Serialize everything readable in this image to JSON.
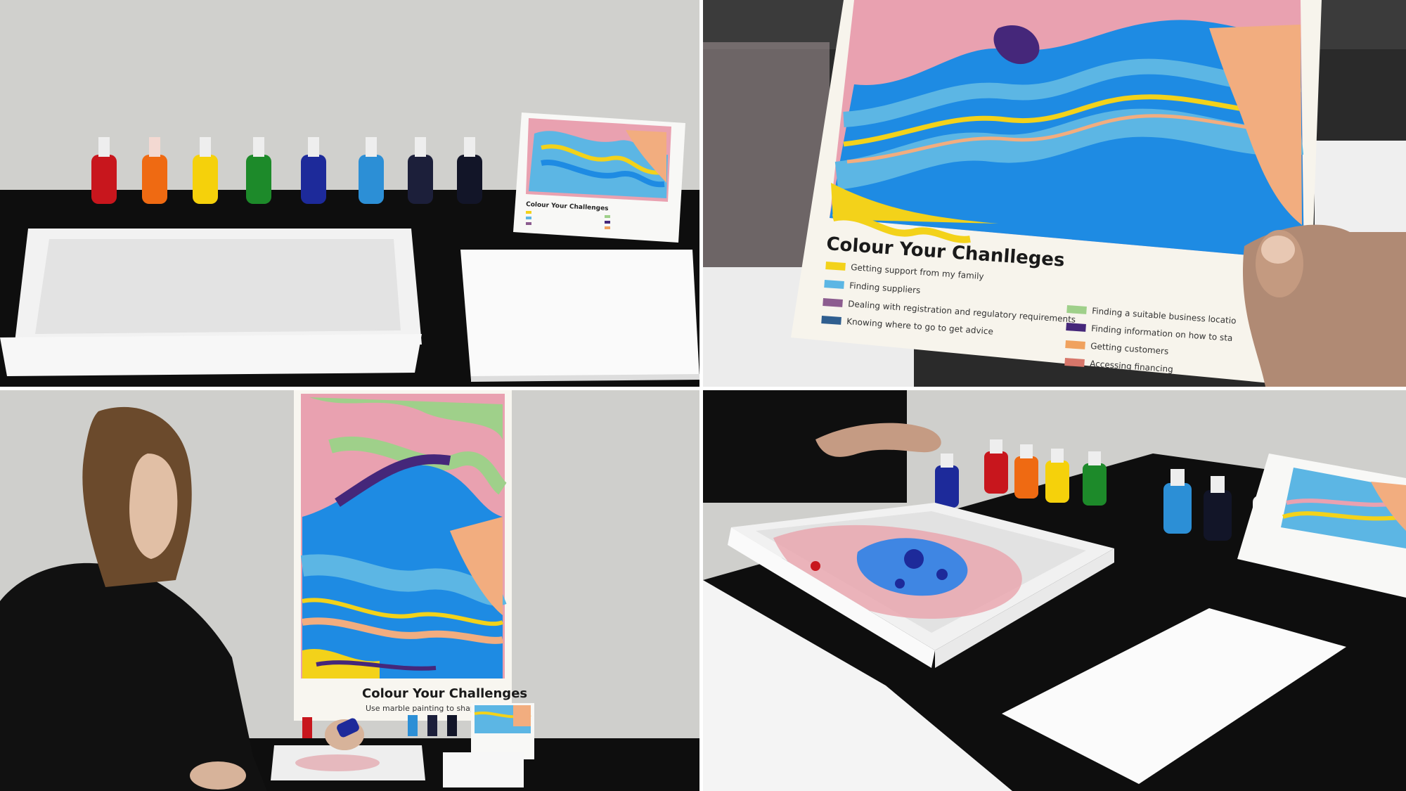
{
  "colors": {
    "yellow": "#f3d21a",
    "light_blue": "#5cb6e4",
    "mauve": "#8c5c8f",
    "navy": "#2f5e8f",
    "green": "#9fd08a",
    "purple": "#45277a",
    "orange": "#f0a25f",
    "red": "#d7766a",
    "pink": "#e9a1b0",
    "blue": "#1e8be3",
    "peach": "#f2ad7f"
  },
  "card_full": {
    "title": "Colour Your Chanlleges",
    "left_items": [
      "Getting support from my family",
      "Finding suppliers",
      "Dealing with registration and regulatory requirements",
      "Knowing where to go to get advice"
    ],
    "right_items": [
      "Finding a suitable business locatio",
      "Finding information on how to sta",
      "Getting customers",
      "Accessing financing"
    ]
  },
  "card_small": {
    "title": "Colour Your Challenges"
  },
  "poster": {
    "title": "Colour Your Challenges",
    "subtitle": "Use marble painting to shape your bu"
  },
  "icons": {
    "bottles": "dropper-bottle-icon",
    "tray": "marbling-tray-icon",
    "paper": "paper-stack-icon"
  }
}
